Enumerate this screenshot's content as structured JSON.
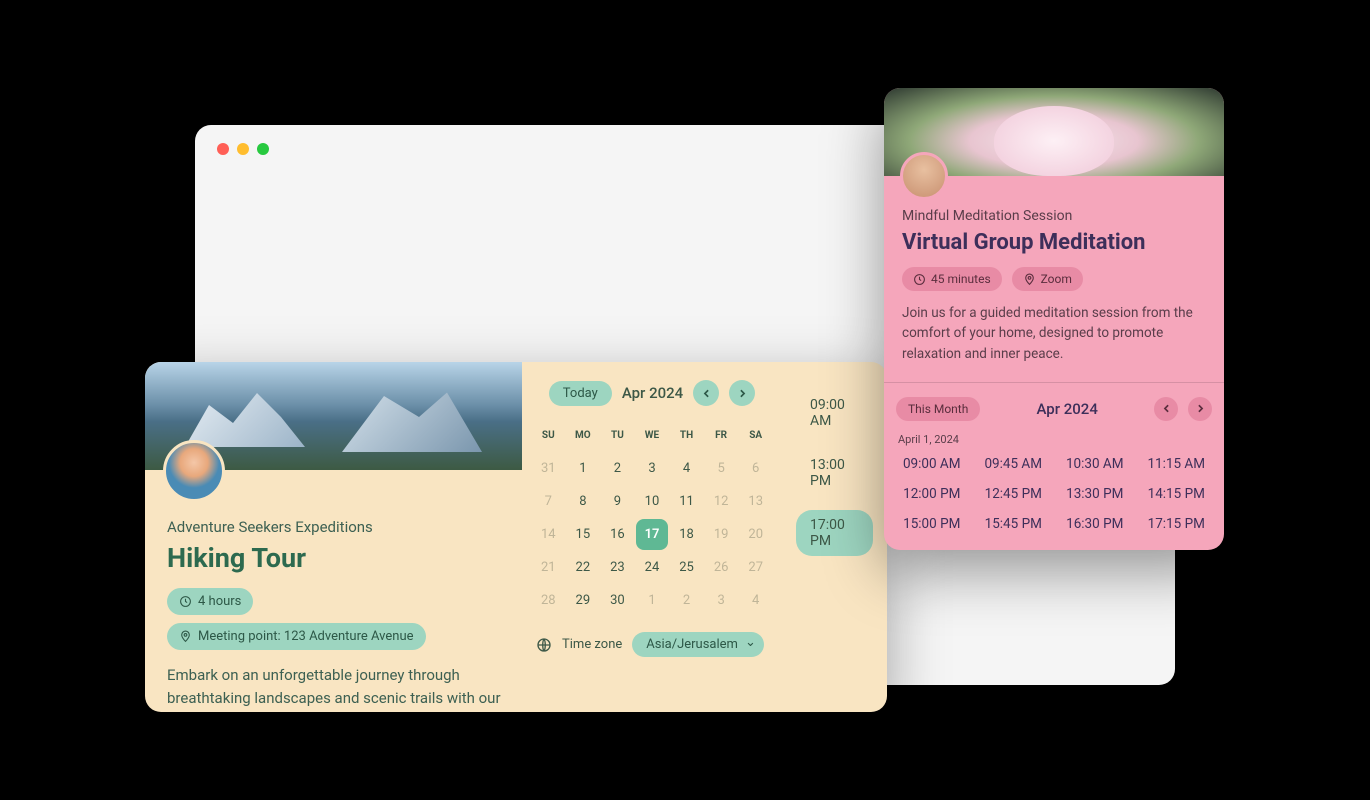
{
  "hiking": {
    "subtitle": "Adventure Seekers Expeditions",
    "title": "Hiking Tour",
    "duration": "4 hours",
    "location": "Meeting point: 123 Adventure Avenue",
    "description": "Embark on an unforgettable journey through breathtaking landscapes and scenic trails with our experienced guides.",
    "calendar": {
      "todayLabel": "Today",
      "month": "Apr 2024",
      "headers": [
        "SU",
        "MO",
        "TU",
        "WE",
        "TH",
        "FR",
        "SA"
      ],
      "days": [
        {
          "n": "31",
          "muted": true
        },
        {
          "n": "1"
        },
        {
          "n": "2"
        },
        {
          "n": "3"
        },
        {
          "n": "4"
        },
        {
          "n": "5",
          "muted": true
        },
        {
          "n": "6",
          "muted": true
        },
        {
          "n": "7",
          "muted": true
        },
        {
          "n": "8"
        },
        {
          "n": "9"
        },
        {
          "n": "10"
        },
        {
          "n": "11"
        },
        {
          "n": "12",
          "muted": true
        },
        {
          "n": "13",
          "muted": true
        },
        {
          "n": "14",
          "muted": true
        },
        {
          "n": "15"
        },
        {
          "n": "16"
        },
        {
          "n": "17",
          "selected": true
        },
        {
          "n": "18"
        },
        {
          "n": "19",
          "muted": true
        },
        {
          "n": "20",
          "muted": true
        },
        {
          "n": "21",
          "muted": true
        },
        {
          "n": "22"
        },
        {
          "n": "23"
        },
        {
          "n": "24"
        },
        {
          "n": "25"
        },
        {
          "n": "26",
          "muted": true
        },
        {
          "n": "27",
          "muted": true
        },
        {
          "n": "28",
          "muted": true
        },
        {
          "n": "29"
        },
        {
          "n": "30"
        },
        {
          "n": "1",
          "muted": true
        },
        {
          "n": "2",
          "muted": true
        },
        {
          "n": "3",
          "muted": true
        },
        {
          "n": "4",
          "muted": true
        }
      ],
      "timezoneLabel": "Time zone",
      "timezone": "Asia/Jerusalem"
    },
    "slots": [
      {
        "t": "09:00 AM"
      },
      {
        "t": "13:00 PM"
      },
      {
        "t": "17:00 PM",
        "selected": true
      }
    ]
  },
  "meditation": {
    "subtitle": "Mindful Meditation Session",
    "title": "Virtual Group Meditation",
    "duration": "45 minutes",
    "location": "Zoom",
    "description": "Join us for a guided meditation session from the comfort of your home, designed to promote relaxation and inner peace.",
    "thisMonthLabel": "This Month",
    "month": "Apr 2024",
    "dateLabel": "April 1, 2024",
    "times": [
      "09:00 AM",
      "09:45 AM",
      "10:30 AM",
      "11:15 AM",
      "12:00 PM",
      "12:45 PM",
      "13:30 PM",
      "14:15 PM",
      "15:00 PM",
      "15:45 PM",
      "16:30 PM",
      "17:15 PM"
    ]
  }
}
